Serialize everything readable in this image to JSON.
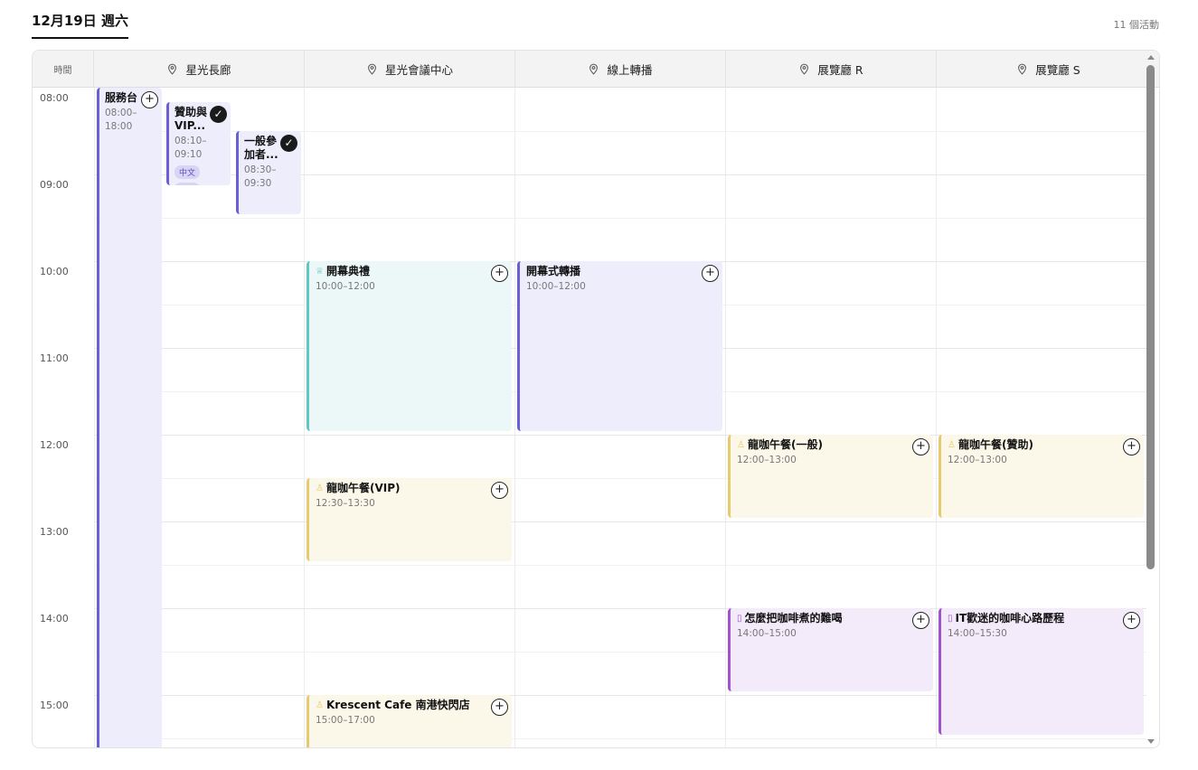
{
  "header": {
    "date_tab": "12月19日 週六",
    "activity_count": "11 個活動"
  },
  "columns": {
    "time_header": "時間",
    "venues": [
      {
        "label": "星光長廊",
        "icon": "location-pin-icon"
      },
      {
        "label": "星光會議中心",
        "icon": "location-pin-icon"
      },
      {
        "label": "線上轉播",
        "icon": "location-pin-icon"
      },
      {
        "label": "展覽廳 R",
        "icon": "location-pin-icon"
      },
      {
        "label": "展覽廳 S",
        "icon": "location-pin-icon"
      }
    ]
  },
  "time_slots": [
    "08:00",
    "09:00",
    "10:00",
    "11:00",
    "12:00",
    "13:00",
    "14:00",
    "15:00"
  ],
  "events": {
    "service_desk": {
      "title": "服務台",
      "time_start": "08:00–",
      "time_end": "18:00",
      "action": "+"
    },
    "sponsor_vip": {
      "title_line1": "贊助與",
      "title_line2": "VIP...",
      "time_start": "08:10–",
      "time_end": "09:10",
      "tag1": "中文",
      "tag2": "英文",
      "status": "✓"
    },
    "general": {
      "title_line1": "一般參",
      "title_line2": "加者...",
      "time_start": "08:30–",
      "time_end": "09:30",
      "status": "✓"
    },
    "opening": {
      "title": "開幕典禮",
      "time": "10:00–12:00",
      "icon": "trophy-icon",
      "action": "+"
    },
    "opening_stream": {
      "title": "開幕式轉播",
      "time": "10:00–12:00",
      "action": "+"
    },
    "lunch_vip": {
      "title": "龍咖午餐(VIP)",
      "time": "12:30–13:30",
      "icon": "lightbulb-icon",
      "action": "+"
    },
    "lunch_general": {
      "title": "龍咖午餐(一般)",
      "time": "12:00–13:00",
      "icon": "lightbulb-icon",
      "action": "+"
    },
    "lunch_sponsor": {
      "title": "龍咖午餐(贊助)",
      "time": "12:00–13:00",
      "icon": "lightbulb-icon",
      "action": "+"
    },
    "coffee_talk": {
      "title": "怎麼把咖啡煮的難喝",
      "time": "14:00–15:00",
      "icon": "book-icon",
      "action": "+"
    },
    "it_coffee": {
      "title": "IT歡迷的咖啡心路歷程",
      "time": "14:00–15:30",
      "icon": "book-icon",
      "action": "+"
    },
    "krescent": {
      "title": "Krescent Cafe 南港快閃店",
      "time": "15:00–17:00",
      "icon": "lightbulb-icon",
      "action": "+"
    }
  },
  "colors": {
    "purple": "#6b5fd6",
    "teal": "#5cc9c4",
    "yellow": "#e8ca6e",
    "violet": "#a052d0"
  }
}
